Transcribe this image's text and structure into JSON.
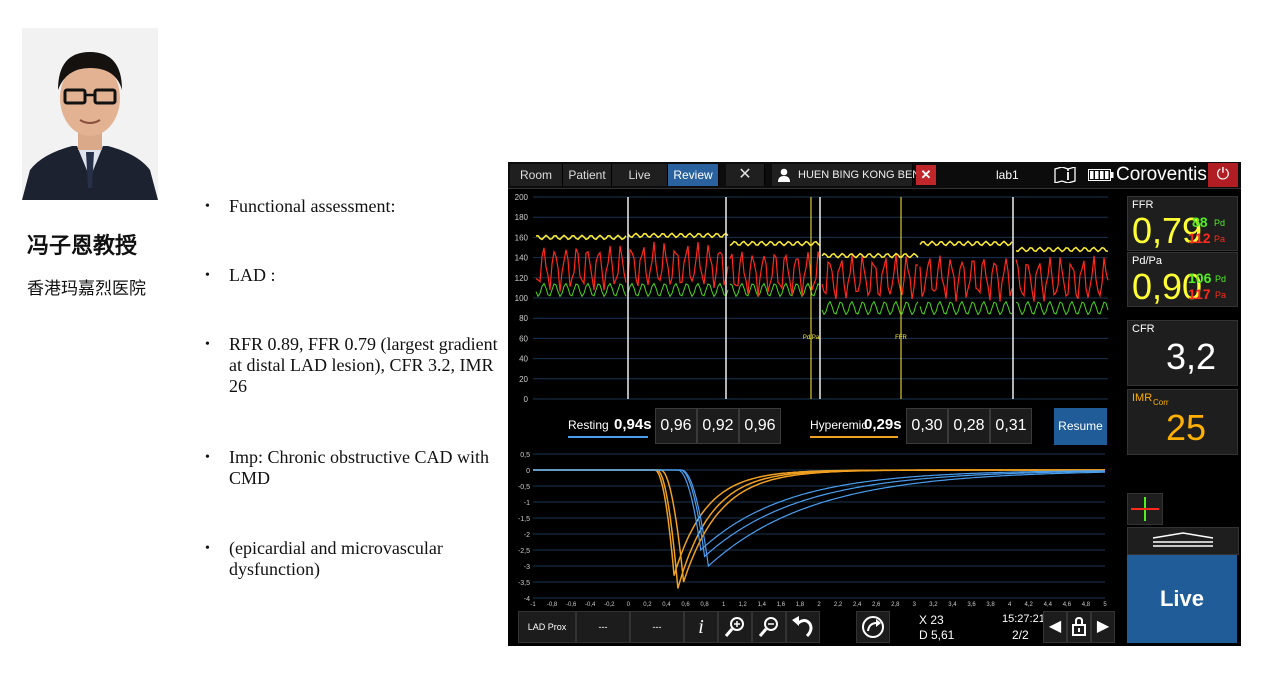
{
  "presenter": {
    "name": "冯子恩教授",
    "hospital": "香港玛嘉烈医院"
  },
  "bullets": [
    "Functional assessment:",
    "LAD :",
    "RFR 0.89, FFR 0.79 (largest gradient at distal LAD lesion), CFR  3.2, IMR  26",
    "Imp: Chronic obstructive CAD with CMD",
    "(epicardial and microvascular dysfunction)"
  ],
  "device": {
    "tabs": [
      "Room",
      "Patient",
      "Live",
      "Review"
    ],
    "active_tab": "Review",
    "patient_name": "HUEN BING KONG BEN",
    "lab": "lab1",
    "brand": "Coroventis",
    "pressure_axis": {
      "ticks": [
        "200",
        "180",
        "160",
        "140",
        "120",
        "100",
        "80",
        "60",
        "40",
        "20",
        "0"
      ],
      "range": [
        0,
        200
      ]
    },
    "markers": [
      "Pd/Pa",
      "FFR"
    ],
    "resting": {
      "label": "Resting",
      "value": "0,94s",
      "segments": [
        "0,96",
        "0,92",
        "0,96"
      ]
    },
    "hyperemic": {
      "label": "Hyperemic",
      "value": "0,29s",
      "segments": [
        "0,30",
        "0,28",
        "0,31"
      ]
    },
    "resume_label": "Resume",
    "thermo_y_ticks": [
      "0,5",
      "0",
      "-0,5",
      "-1",
      "-1,5",
      "-2",
      "-2,5",
      "-3",
      "-3,5",
      "-4"
    ],
    "thermo_x_ticks": [
      "-1",
      "-0,8",
      "-0,6",
      "-0,4",
      "-0,2",
      "0",
      "0,2",
      "0,4",
      "0,6",
      "0,8",
      "1",
      "1,2",
      "1,4",
      "1,6",
      "1,8",
      "2",
      "2,2",
      "2,4",
      "2,6",
      "2,8",
      "3",
      "3,2",
      "3,4",
      "3,6",
      "3,8",
      "4",
      "4,2",
      "4,4",
      "4,6",
      "4,8",
      "5"
    ],
    "panels": {
      "ffr": {
        "label": "FFR",
        "value": "0,79",
        "pd": "88",
        "pd_unit": "Pd",
        "pa": "112",
        "pa_unit": "Pa"
      },
      "pdpa": {
        "label": "Pd/Pa",
        "value": "0,90",
        "pd": "106",
        "pd_unit": "Pd",
        "pa": "117",
        "pa_unit": "Pa"
      },
      "cfr": {
        "label": "CFR",
        "value": "3,2"
      },
      "imr": {
        "label": "IMR",
        "sub": "Corr",
        "value": "25"
      }
    },
    "live_label": "Live",
    "bottom": {
      "location": "LAD Prox",
      "slot2": "---",
      "slot3": "---",
      "x_readout": "X 23",
      "d_readout": "D 5,61",
      "time": "15:27:21",
      "page": "2/2"
    },
    "colors": {
      "pd": "#ff2a1a",
      "pa": "#ffee33",
      "ratio": "#4ff020",
      "resting": "#4a9ef0",
      "hyperemic": "#f0a020",
      "panel_yellow": "#ffff33",
      "imr_orange": "#ffb000"
    }
  }
}
